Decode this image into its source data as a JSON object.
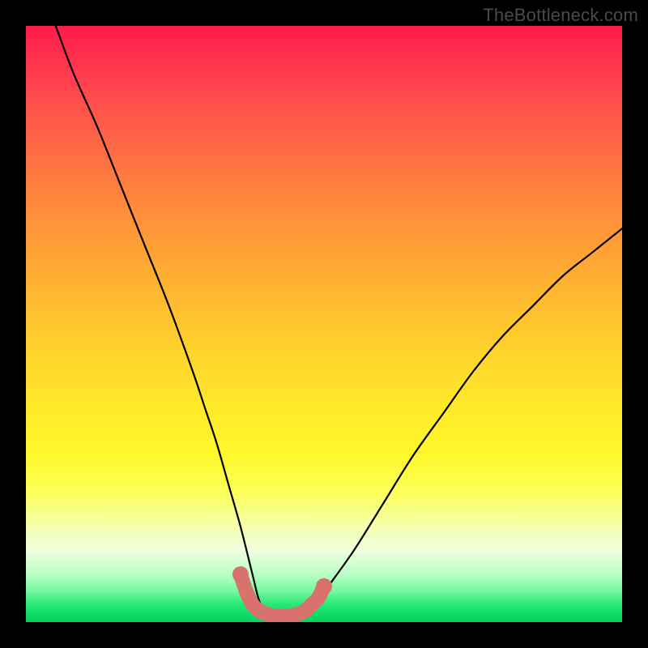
{
  "watermark": "TheBottleneck.com",
  "chart_data": {
    "type": "line",
    "title": "",
    "xlabel": "",
    "ylabel": "",
    "xlim": [
      0,
      100
    ],
    "ylim": [
      0,
      100
    ],
    "series": [
      {
        "name": "bottleneck-curve",
        "x": [
          5,
          8,
          12,
          16,
          20,
          24,
          28,
          30,
          32,
          34,
          36,
          38,
          39,
          40,
          42,
          44,
          46,
          48,
          50,
          55,
          60,
          65,
          70,
          75,
          80,
          85,
          90,
          95,
          100
        ],
        "y": [
          100,
          92,
          83,
          73,
          63,
          53,
          42,
          36,
          30,
          23,
          16,
          8,
          4,
          2,
          1,
          1,
          1,
          2,
          5,
          12,
          20,
          28,
          35,
          42,
          48,
          53,
          58,
          62,
          66
        ]
      }
    ],
    "markers": {
      "name": "trough-markers",
      "color": "#d9726e",
      "x": [
        36,
        37,
        38,
        39,
        40,
        41,
        42,
        43,
        44,
        45,
        46,
        47,
        48,
        49,
        50
      ],
      "y": [
        8,
        5,
        3,
        2,
        1.5,
        1.2,
        1,
        1,
        1,
        1.2,
        1.5,
        2,
        3,
        4,
        6
      ]
    }
  }
}
